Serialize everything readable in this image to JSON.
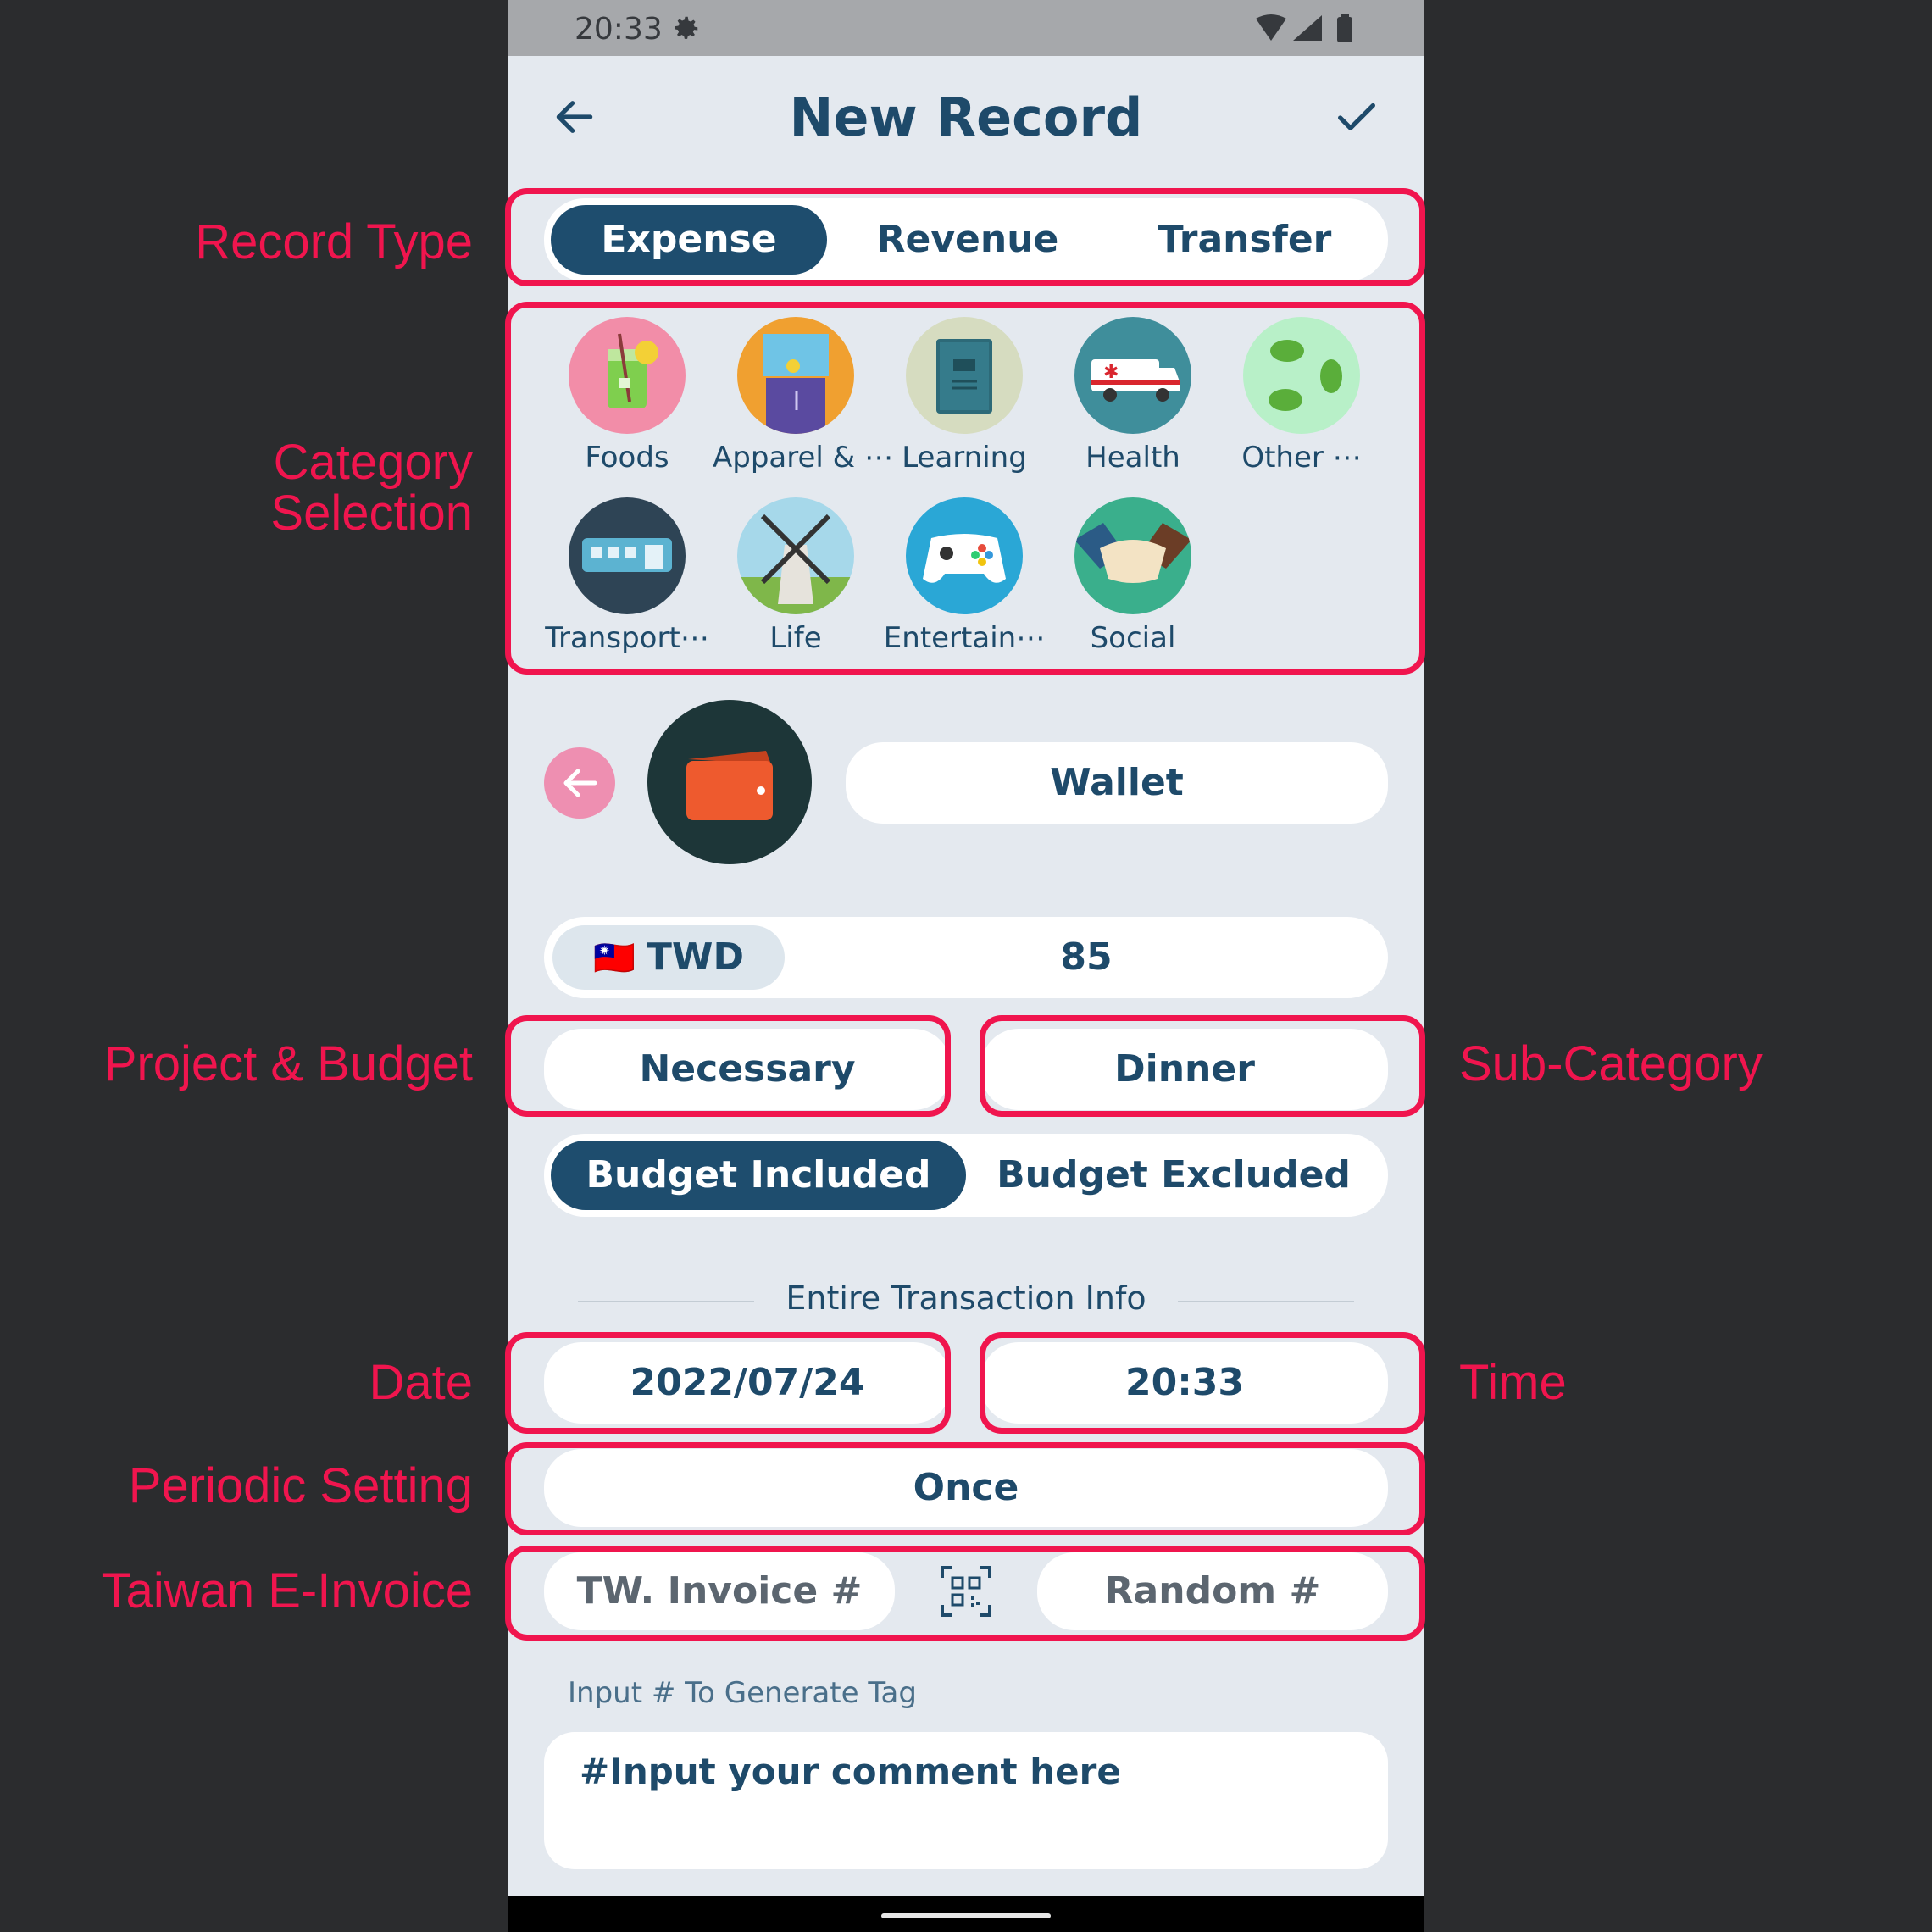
{
  "status_bar": {
    "time": "20:33"
  },
  "app_bar": {
    "title": "New Record"
  },
  "record_type": {
    "options": [
      "Expense",
      "Revenue",
      "Transfer"
    ],
    "selected": "Expense"
  },
  "categories": [
    {
      "label": "Foods",
      "icon": "drink-glass-icon"
    },
    {
      "label": "Apparel & ⋯",
      "icon": "clothing-icon"
    },
    {
      "label": "Learning",
      "icon": "book-icon"
    },
    {
      "label": "Health",
      "icon": "ambulance-icon"
    },
    {
      "label": "Other ⋯",
      "icon": "leaves-icon"
    },
    {
      "label": "Transport⋯",
      "icon": "train-icon"
    },
    {
      "label": "Life",
      "icon": "windmill-icon"
    },
    {
      "label": "Entertain⋯",
      "icon": "gamepad-icon"
    },
    {
      "label": "Social",
      "icon": "handshake-icon"
    }
  ],
  "account": {
    "name": "Wallet",
    "icon": "wallet-icon"
  },
  "amount": {
    "currency": "TWD",
    "flag": "🇹🇼",
    "value": "85"
  },
  "project": "Necessary",
  "sub_category": "Dinner",
  "budget": {
    "options": [
      "Budget Included",
      "Budget Excluded"
    ],
    "selected": "Budget Included"
  },
  "section_title": "Entire Transaction Info",
  "date": "2022/07/24",
  "time": "20:33",
  "periodic": "Once",
  "invoice": {
    "invoice_placeholder": "TW. Invoice #",
    "random_placeholder": "Random #"
  },
  "tag_hint": "Input # To Generate Tag",
  "comment": "#Input your comment here",
  "annotations": {
    "record_type": "Record Type",
    "category_line1": "Category",
    "category_line2": "Selection",
    "project_budget": "Project & Budget",
    "sub_category": "Sub-Category",
    "date": "Date",
    "time": "Time",
    "periodic": "Periodic Setting",
    "einvoice": "Taiwan E-Invoice"
  },
  "colors": {
    "accent": "#1e4d6e",
    "annotation": "#f0154e",
    "background": "#e4e9ef"
  }
}
